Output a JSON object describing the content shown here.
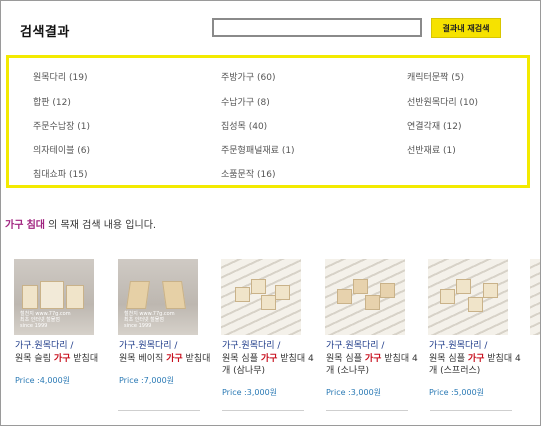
{
  "header": {
    "title": "검색결과",
    "search_value": "",
    "search_button": "결과내 재검색"
  },
  "categories": [
    {
      "label": "원목다리 (19)"
    },
    {
      "label": "주방가구 (60)"
    },
    {
      "label": "캐릭터문짝 (5)"
    },
    {
      "label": "합판 (12)"
    },
    {
      "label": "수납가구 (8)"
    },
    {
      "label": "선반원목다리 (10)"
    },
    {
      "label": "주문수납장 (1)"
    },
    {
      "label": "집성목 (40)"
    },
    {
      "label": "연결각재 (12)"
    },
    {
      "label": "의자테이블 (6)"
    },
    {
      "label": "주문형패널재료 (1)"
    },
    {
      "label": "선반재료 (1)"
    },
    {
      "label": "침대쇼파 (15)"
    },
    {
      "label": "소품문작 (16)"
    }
  ],
  "result_info": {
    "keyword1": "가구",
    "keyword2": "침대",
    "suffix": " 의 목재 검색 내용 입니다."
  },
  "products": [
    {
      "category": "가구.원목다리 /",
      "name_pre": "원목 슬림 ",
      "name_hl": "가구",
      "name_post": " 받침대",
      "price": "Price :4,000원",
      "watermark": "철천지 www.77g.com\n최초 인터넷 철물점\nsince 1999"
    },
    {
      "category": "가구.원목다리 /",
      "name_pre": "원목 베이직 ",
      "name_hl": "가구",
      "name_post": " 받침대",
      "price": "Price :7,000원",
      "watermark": "철천지 www.77g.com\n최초 인터넷 철물점\nsince 1999"
    },
    {
      "category": "가구.원목다리 /",
      "name_pre": "원목 심플 ",
      "name_hl": "가구",
      "name_post": " 받침대 4개 (삼나무)",
      "price": "Price :3,000원",
      "watermark": ""
    },
    {
      "category": "가구.원목다리 /",
      "name_pre": "원목 심플 ",
      "name_hl": "가구",
      "name_post": " 받침대 4개 (소나무)",
      "price": "Price :3,000원",
      "watermark": ""
    },
    {
      "category": "가구.원목다리 /",
      "name_pre": "원목 심플 ",
      "name_hl": "가구",
      "name_post": " 받침대 4개 (스프러스)",
      "price": "Price :5,000원",
      "watermark": ""
    }
  ],
  "colors": {
    "accent_yellow": "#f6e200",
    "box_border": "#f3ea00",
    "keyword_purple": "#a0237f",
    "highlight_red": "#c8101e",
    "link_blue": "#1f3c8a",
    "price_blue": "#2b7ab5"
  }
}
